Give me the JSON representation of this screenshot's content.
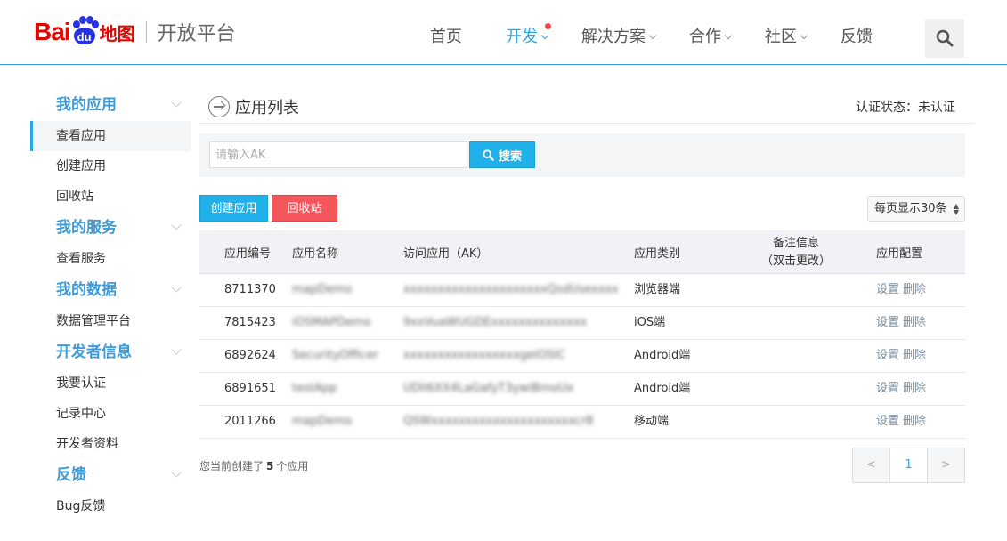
{
  "brand": {
    "logo_bai": "Bai",
    "logo_du": "du",
    "logo_map": "地图",
    "subtitle": "开放平台"
  },
  "nav": {
    "items": [
      {
        "label": "首页",
        "has_dropdown": false
      },
      {
        "label": "开发",
        "has_dropdown": true,
        "active": true,
        "badge_dot": true
      },
      {
        "label": "解决方案",
        "has_dropdown": true
      },
      {
        "label": "合作",
        "has_dropdown": true
      },
      {
        "label": "社区",
        "has_dropdown": true
      },
      {
        "label": "反馈",
        "has_dropdown": false
      }
    ],
    "search_icon": "search-icon"
  },
  "sidebar": {
    "groups": [
      {
        "title": "我的应用",
        "items": [
          "查看应用",
          "创建应用",
          "回收站"
        ]
      },
      {
        "title": "我的服务",
        "items": [
          "查看服务"
        ]
      },
      {
        "title": "我的数据",
        "items": [
          "数据管理平台"
        ]
      },
      {
        "title": "开发者信息",
        "items": [
          "我要认证",
          "记录中心",
          "开发者资料"
        ]
      },
      {
        "title": "反馈",
        "items": [
          "Bug反馈"
        ]
      }
    ],
    "active_item": "查看应用"
  },
  "main": {
    "title": "应用列表",
    "auth_status": "认证状态：未认证",
    "search": {
      "placeholder": "请输入AK",
      "value": "",
      "button_label": "搜索"
    },
    "buttons": {
      "create": "创建应用",
      "recycle": "回收站"
    },
    "per_page": "每页显示30条",
    "table": {
      "headers": [
        "应用编号",
        "应用名称",
        "访问应用（AK）",
        "应用类别",
        "备注信息",
        "（双击更改）",
        "应用配置"
      ],
      "rows": [
        {
          "id": "8711370",
          "name": "mapDemo",
          "ak": "xxxxxxxxxxxxxxxxxxxxxQsdUsexxxx",
          "category": "浏览器端",
          "ops": [
            "设置",
            "删除"
          ]
        },
        {
          "id": "7815423",
          "name": "iOSMAPDemo",
          "ak": "9xxVuaWUGDExxxxxxxxxxxxxx",
          "category": "iOS端",
          "ops": [
            "设置",
            "删除"
          ]
        },
        {
          "id": "6892624",
          "name": "SecurityOfficer",
          "ak": "xxxxxxxxxxxxxxxxxgelOSIC",
          "category": "Android端",
          "ops": [
            "设置",
            "删除"
          ]
        },
        {
          "id": "6891651",
          "name": "testApp",
          "ak": "UDli6XX4LaGafyT3ywiBmoUx",
          "category": "Android端",
          "ops": [
            "设置",
            "删除"
          ]
        },
        {
          "id": "2011266",
          "name": "mapDemo",
          "ak": "QSWxxxxxxxxxxxxxxxxxxxxxcr8",
          "category": "移动端",
          "ops": [
            "设置",
            "删除"
          ]
        }
      ]
    },
    "footer": {
      "count_prefix": "您当前创建了",
      "count": "5",
      "count_suffix": "个应用"
    },
    "pager": {
      "prev": "<",
      "current": "1",
      "next": ">"
    }
  },
  "colors": {
    "accent": "#2aa7e8",
    "danger": "#f5565b",
    "brand_red": "#e10601",
    "brand_blue": "#2932e1"
  }
}
